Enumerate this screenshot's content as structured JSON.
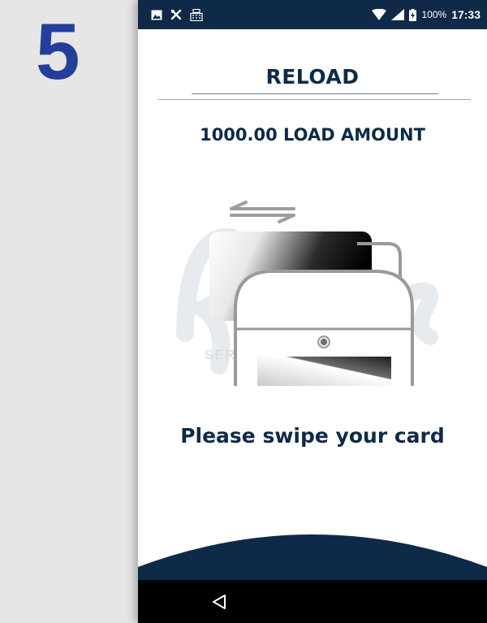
{
  "step": {
    "number": "5"
  },
  "status_bar": {
    "icons_left": [
      "image-icon",
      "wrench-icon",
      "cash-register-icon"
    ],
    "icons_right": [
      "wifi-icon",
      "signal-icon",
      "battery-charging-icon"
    ],
    "battery": "100%",
    "time": "17:33"
  },
  "screen": {
    "title": "RELOAD",
    "amount_text": "1000.00 LOAD AMOUNT",
    "illustration": {
      "icons": [
        "swipe-arrows-icon",
        "card-icon",
        "card-reader-icon"
      ],
      "watermark_text": "SER"
    },
    "prompt": "Please swipe your card"
  },
  "nav_bar": {
    "icons": [
      "back-triangle-icon"
    ]
  },
  "colors": {
    "brand_navy": "#0e2a48",
    "step_blue": "#233f9a",
    "background_gray": "#e6e6e6",
    "outline_gray": "#9a9a9a"
  }
}
